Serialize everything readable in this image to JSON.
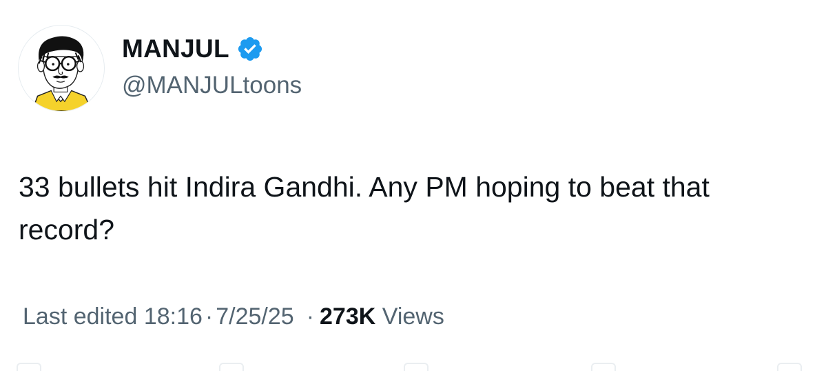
{
  "author": {
    "display_name": "MANJUL",
    "handle": "@MANJULtoons",
    "verified": true,
    "verified_color": "#1d9bf0",
    "avatar": "cartoon-self-portrait"
  },
  "tweet": {
    "text": "33 bullets hit Indira Gandhi. Any PM hoping to beat that record?"
  },
  "meta": {
    "edited_label": "Last edited",
    "time": "18:16",
    "separator": "·",
    "date": "7/25/25",
    "views_count": "273K",
    "views_label": "Views"
  },
  "colors": {
    "text_primary": "#0f1419",
    "text_secondary": "#536471",
    "accent": "#1d9bf0"
  }
}
